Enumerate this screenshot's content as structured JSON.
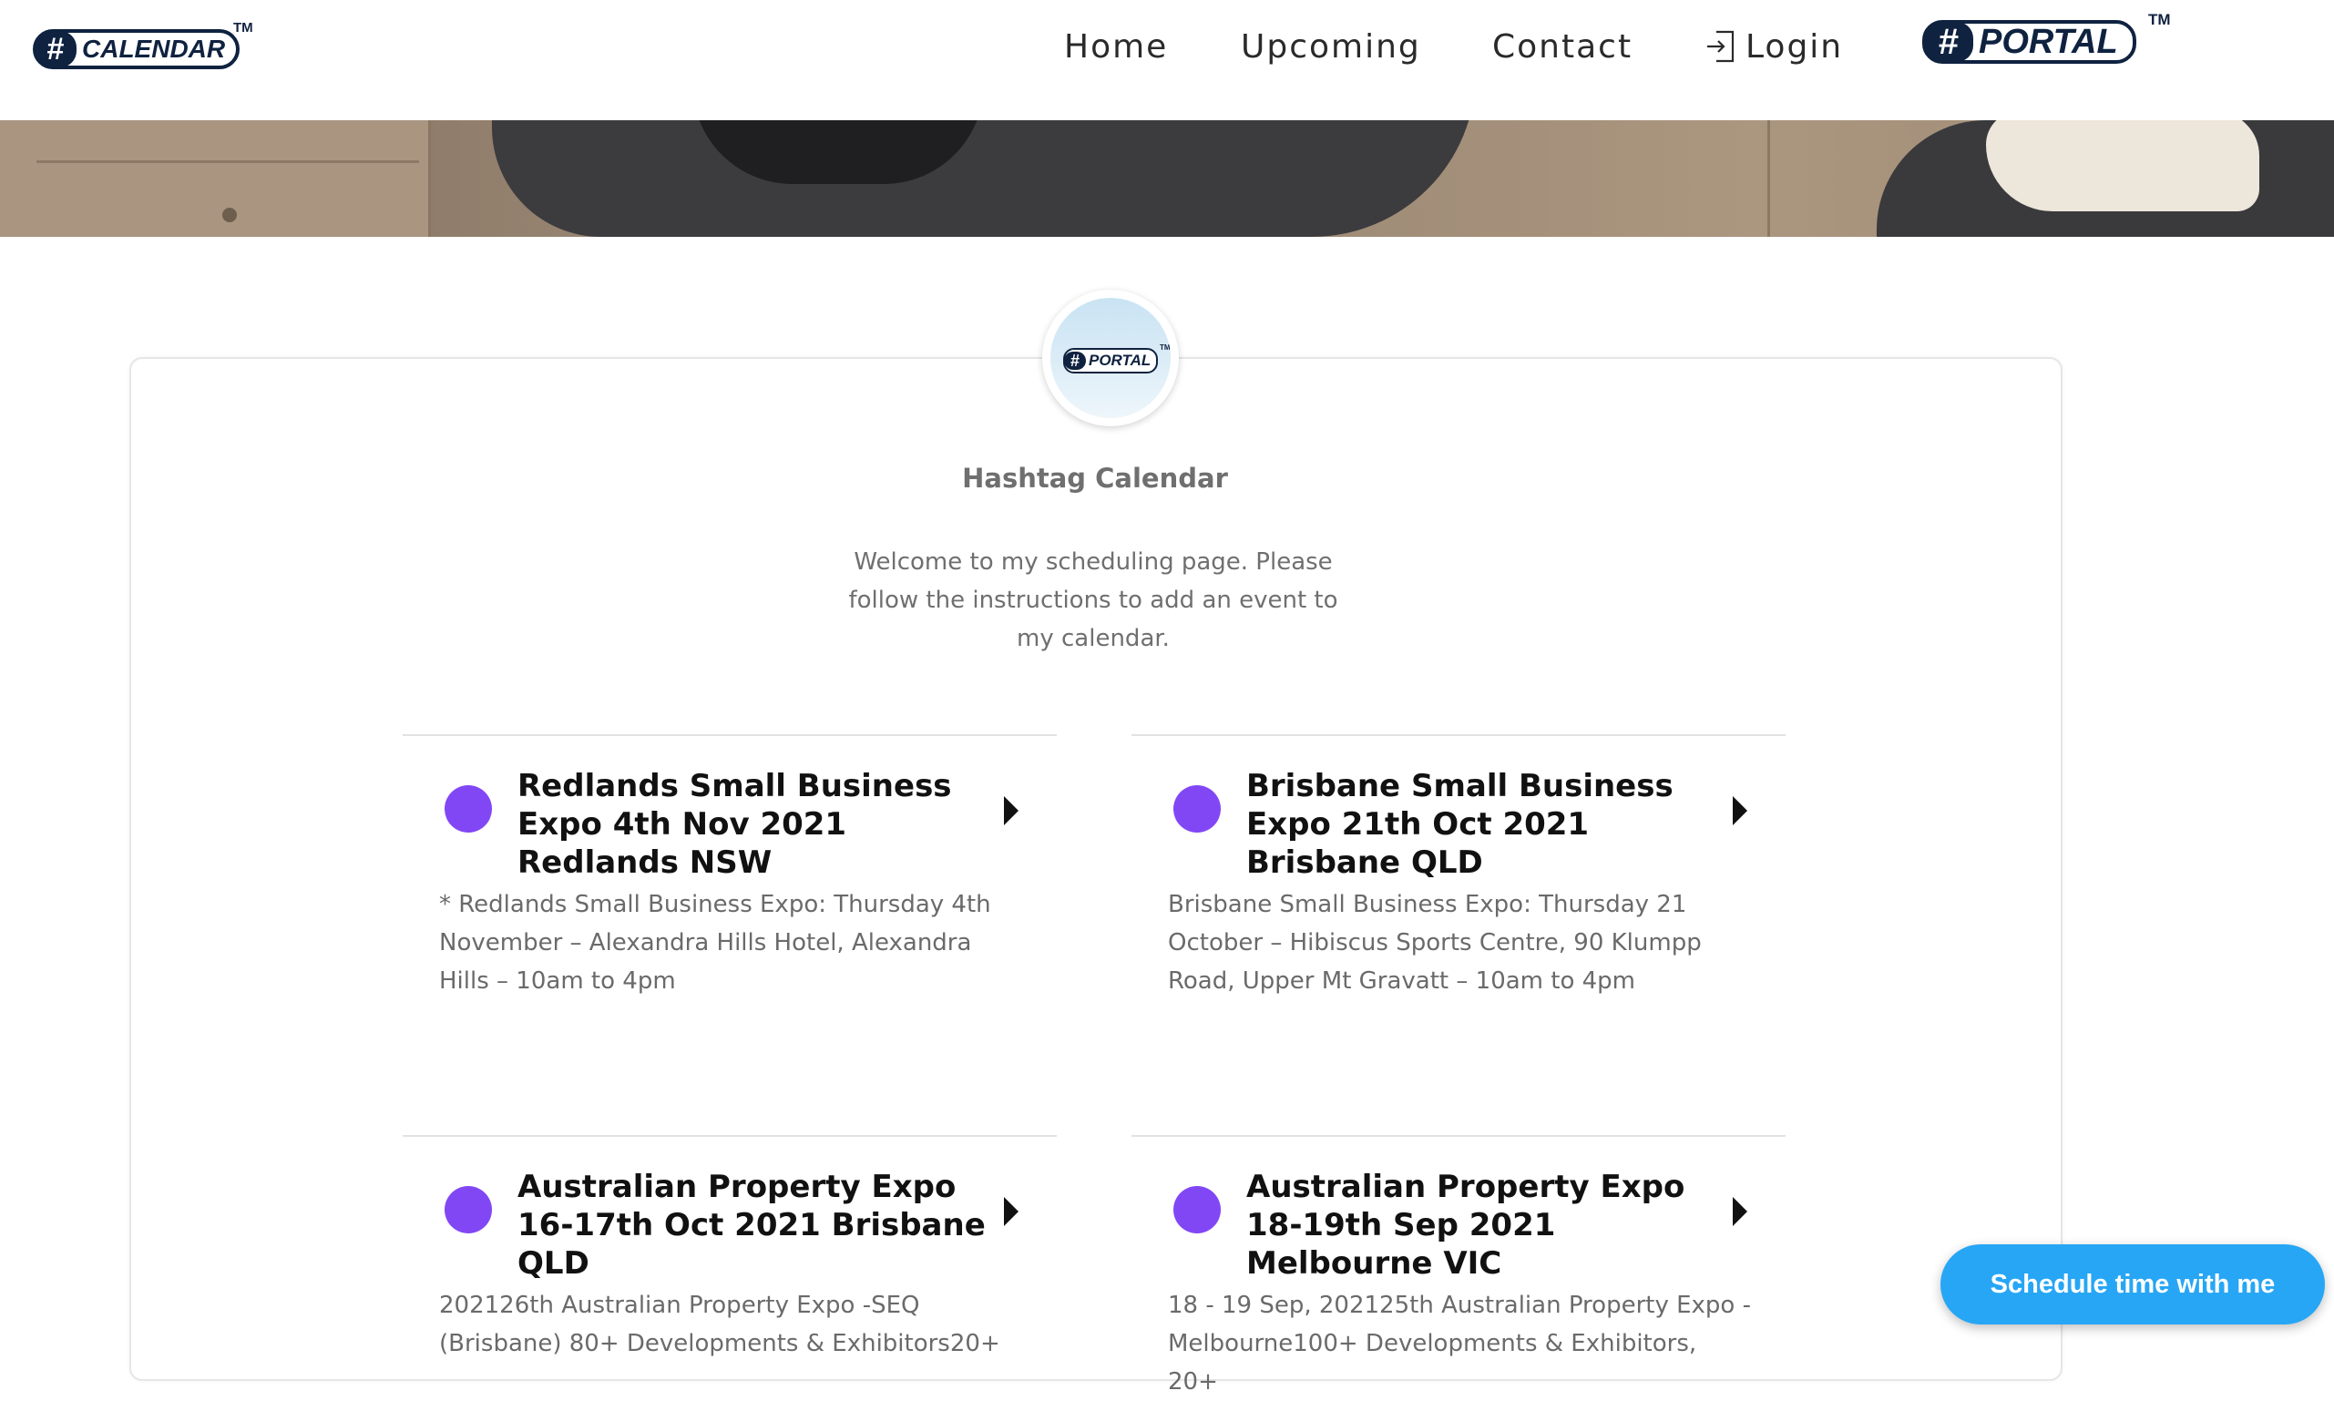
{
  "header": {
    "logo_text": "CALENDAR",
    "logo_hash": "#",
    "logo_tm": "TM",
    "nav": {
      "home": "Home",
      "upcoming": "Upcoming",
      "contact": "Contact",
      "login": "Login"
    },
    "portal_logo_text": "PORTAL",
    "portal_logo_hash": "#",
    "portal_tm": "TM"
  },
  "profile": {
    "avatar_text": "PORTAL",
    "avatar_hash": "#",
    "avatar_tm": "TM",
    "name": "Hashtag Calendar",
    "welcome": "Welcome to my scheduling page. Please follow the instructions to add an event to my calendar."
  },
  "events": [
    {
      "title": "Redlands Small Business Expo 4th Nov 2021 Redlands NSW",
      "description": "* Redlands Small Business Expo: Thursday 4th November – Alexandra Hills Hotel, Alexandra Hills – 10am to 4pm",
      "color": "#8247f5"
    },
    {
      "title": "Brisbane Small Business Expo 21th Oct 2021 Brisbane QLD",
      "description": "Brisbane Small Business Expo: Thursday 21 October – Hibiscus Sports Centre, 90 Klumpp Road, Upper Mt Gravatt – 10am to 4pm",
      "color": "#8247f5"
    },
    {
      "title": "Australian Property Expo 16-17th Oct 2021 Brisbane QLD",
      "description": "202126th Australian Property Expo -SEQ (Brisbane) 80+ Developments & Exhibitors20+",
      "color": "#8247f5"
    },
    {
      "title": "Australian Property Expo 18-19th Sep 2021 Melbourne VIC",
      "description": "18 - 19 Sep, 202125th Australian Property Expo - Melbourne100+ Developments & Exhibitors, 20+",
      "color": "#8247f5"
    }
  ],
  "schedule_button": "Schedule time with me",
  "colors": {
    "brand_navy": "#0f2240",
    "event_dot": "#8247f5",
    "schedule_button": "#27a6f5"
  }
}
